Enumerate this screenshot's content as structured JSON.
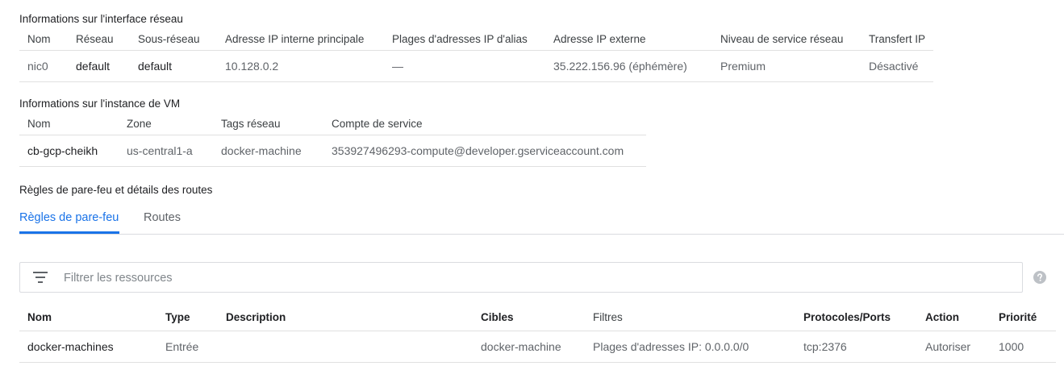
{
  "network_interface": {
    "title": "Informations sur l'interface réseau",
    "columns": [
      "Nom",
      "Réseau",
      "Sous-réseau",
      "Adresse IP interne principale",
      "Plages d'adresses IP d'alias",
      "Adresse IP externe",
      "Niveau de service réseau",
      "Transfert IP"
    ],
    "row": {
      "name": "nic0",
      "network": "default",
      "subnet": "default",
      "internal_ip": "10.128.0.2",
      "alias_ranges": "—",
      "external_ip": "35.222.156.96 (éphémère)",
      "tier": "Premium",
      "ip_forwarding": "Désactivé"
    }
  },
  "vm_instance": {
    "title": "Informations sur l'instance de VM",
    "columns": [
      "Nom",
      "Zone",
      "Tags réseau",
      "Compte de service"
    ],
    "row": {
      "name": "cb-gcp-cheikh",
      "zone": "us-central1-a",
      "tags": "docker-machine",
      "service_account": "353927496293-compute@developer.gserviceaccount.com"
    }
  },
  "firewall": {
    "title": "Règles de pare-feu et détails des routes",
    "tabs": [
      "Règles de pare-feu",
      "Routes"
    ],
    "active_tab": "Règles de pare-feu",
    "filter_placeholder": "Filtrer les ressources",
    "columns": [
      "Nom",
      "Type",
      "Description",
      "Cibles",
      "Filtres",
      "Protocoles/Ports",
      "Action",
      "Priorité"
    ],
    "rows": [
      {
        "name": "docker-machines",
        "type": "Entrée",
        "description": "",
        "targets": "docker-machine",
        "filters": "Plages d'adresses IP: 0.0.0.0/0",
        "ports": "tcp:2376",
        "action": "Autoriser",
        "priority": "1000"
      }
    ]
  },
  "icons": {
    "filter": "filter-lines-icon",
    "help": "help-circle-icon"
  },
  "colors": {
    "accent": "#1a73e8",
    "divider": "#e0e0e0",
    "muted_text": "#5f6368"
  }
}
